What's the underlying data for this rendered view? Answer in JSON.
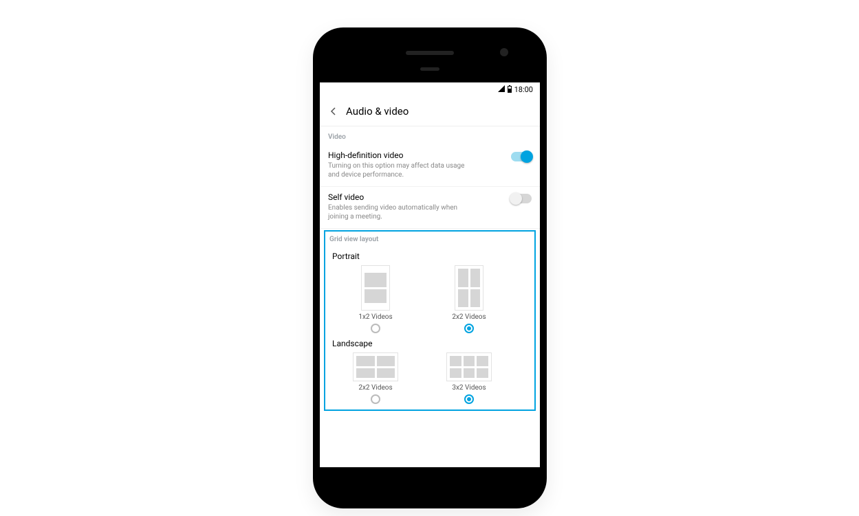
{
  "status_bar": {
    "time": "18:00"
  },
  "app_bar": {
    "title": "Audio & video"
  },
  "video_section": {
    "header": "Video",
    "hd": {
      "title": "High-definition video",
      "desc": "Turning on this option may affect data usage and device performance.",
      "on": true
    },
    "self": {
      "title": "Self video",
      "desc": "Enables sending video automatically when joining a meeting.",
      "on": false
    }
  },
  "grid_section": {
    "header": "Grid view layout",
    "portrait": {
      "label": "Portrait",
      "options": [
        {
          "caption": "1x2 Videos",
          "selected": false
        },
        {
          "caption": "2x2 Videos",
          "selected": true
        }
      ]
    },
    "landscape": {
      "label": "Landscape",
      "options": [
        {
          "caption": "2x2 Videos",
          "selected": false
        },
        {
          "caption": "3x2 Videos",
          "selected": true
        }
      ]
    }
  }
}
